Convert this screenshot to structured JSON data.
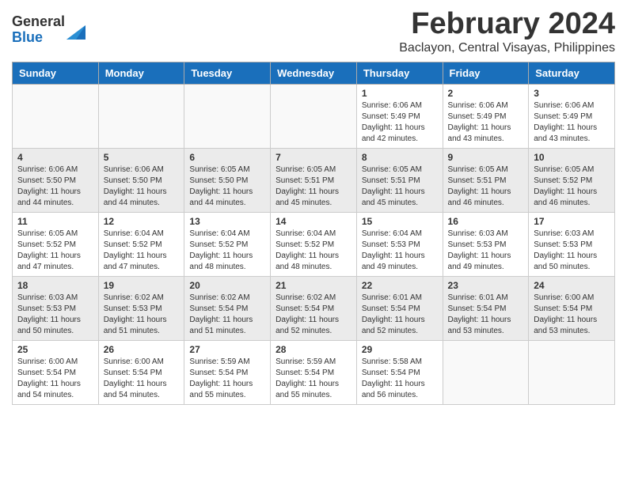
{
  "logo": {
    "general": "General",
    "blue": "Blue"
  },
  "title": {
    "month": "February 2024",
    "location": "Baclayon, Central Visayas, Philippines"
  },
  "headers": [
    "Sunday",
    "Monday",
    "Tuesday",
    "Wednesday",
    "Thursday",
    "Friday",
    "Saturday"
  ],
  "weeks": [
    [
      {
        "day": "",
        "info": ""
      },
      {
        "day": "",
        "info": ""
      },
      {
        "day": "",
        "info": ""
      },
      {
        "day": "",
        "info": ""
      },
      {
        "day": "1",
        "info": "Sunrise: 6:06 AM\nSunset: 5:49 PM\nDaylight: 11 hours\nand 42 minutes."
      },
      {
        "day": "2",
        "info": "Sunrise: 6:06 AM\nSunset: 5:49 PM\nDaylight: 11 hours\nand 43 minutes."
      },
      {
        "day": "3",
        "info": "Sunrise: 6:06 AM\nSunset: 5:49 PM\nDaylight: 11 hours\nand 43 minutes."
      }
    ],
    [
      {
        "day": "4",
        "info": "Sunrise: 6:06 AM\nSunset: 5:50 PM\nDaylight: 11 hours\nand 44 minutes."
      },
      {
        "day": "5",
        "info": "Sunrise: 6:06 AM\nSunset: 5:50 PM\nDaylight: 11 hours\nand 44 minutes."
      },
      {
        "day": "6",
        "info": "Sunrise: 6:05 AM\nSunset: 5:50 PM\nDaylight: 11 hours\nand 44 minutes."
      },
      {
        "day": "7",
        "info": "Sunrise: 6:05 AM\nSunset: 5:51 PM\nDaylight: 11 hours\nand 45 minutes."
      },
      {
        "day": "8",
        "info": "Sunrise: 6:05 AM\nSunset: 5:51 PM\nDaylight: 11 hours\nand 45 minutes."
      },
      {
        "day": "9",
        "info": "Sunrise: 6:05 AM\nSunset: 5:51 PM\nDaylight: 11 hours\nand 46 minutes."
      },
      {
        "day": "10",
        "info": "Sunrise: 6:05 AM\nSunset: 5:52 PM\nDaylight: 11 hours\nand 46 minutes."
      }
    ],
    [
      {
        "day": "11",
        "info": "Sunrise: 6:05 AM\nSunset: 5:52 PM\nDaylight: 11 hours\nand 47 minutes."
      },
      {
        "day": "12",
        "info": "Sunrise: 6:04 AM\nSunset: 5:52 PM\nDaylight: 11 hours\nand 47 minutes."
      },
      {
        "day": "13",
        "info": "Sunrise: 6:04 AM\nSunset: 5:52 PM\nDaylight: 11 hours\nand 48 minutes."
      },
      {
        "day": "14",
        "info": "Sunrise: 6:04 AM\nSunset: 5:52 PM\nDaylight: 11 hours\nand 48 minutes."
      },
      {
        "day": "15",
        "info": "Sunrise: 6:04 AM\nSunset: 5:53 PM\nDaylight: 11 hours\nand 49 minutes."
      },
      {
        "day": "16",
        "info": "Sunrise: 6:03 AM\nSunset: 5:53 PM\nDaylight: 11 hours\nand 49 minutes."
      },
      {
        "day": "17",
        "info": "Sunrise: 6:03 AM\nSunset: 5:53 PM\nDaylight: 11 hours\nand 50 minutes."
      }
    ],
    [
      {
        "day": "18",
        "info": "Sunrise: 6:03 AM\nSunset: 5:53 PM\nDaylight: 11 hours\nand 50 minutes."
      },
      {
        "day": "19",
        "info": "Sunrise: 6:02 AM\nSunset: 5:53 PM\nDaylight: 11 hours\nand 51 minutes."
      },
      {
        "day": "20",
        "info": "Sunrise: 6:02 AM\nSunset: 5:54 PM\nDaylight: 11 hours\nand 51 minutes."
      },
      {
        "day": "21",
        "info": "Sunrise: 6:02 AM\nSunset: 5:54 PM\nDaylight: 11 hours\nand 52 minutes."
      },
      {
        "day": "22",
        "info": "Sunrise: 6:01 AM\nSunset: 5:54 PM\nDaylight: 11 hours\nand 52 minutes."
      },
      {
        "day": "23",
        "info": "Sunrise: 6:01 AM\nSunset: 5:54 PM\nDaylight: 11 hours\nand 53 minutes."
      },
      {
        "day": "24",
        "info": "Sunrise: 6:00 AM\nSunset: 5:54 PM\nDaylight: 11 hours\nand 53 minutes."
      }
    ],
    [
      {
        "day": "25",
        "info": "Sunrise: 6:00 AM\nSunset: 5:54 PM\nDaylight: 11 hours\nand 54 minutes."
      },
      {
        "day": "26",
        "info": "Sunrise: 6:00 AM\nSunset: 5:54 PM\nDaylight: 11 hours\nand 54 minutes."
      },
      {
        "day": "27",
        "info": "Sunrise: 5:59 AM\nSunset: 5:54 PM\nDaylight: 11 hours\nand 55 minutes."
      },
      {
        "day": "28",
        "info": "Sunrise: 5:59 AM\nSunset: 5:54 PM\nDaylight: 11 hours\nand 55 minutes."
      },
      {
        "day": "29",
        "info": "Sunrise: 5:58 AM\nSunset: 5:54 PM\nDaylight: 11 hours\nand 56 minutes."
      },
      {
        "day": "",
        "info": ""
      },
      {
        "day": "",
        "info": ""
      }
    ]
  ]
}
